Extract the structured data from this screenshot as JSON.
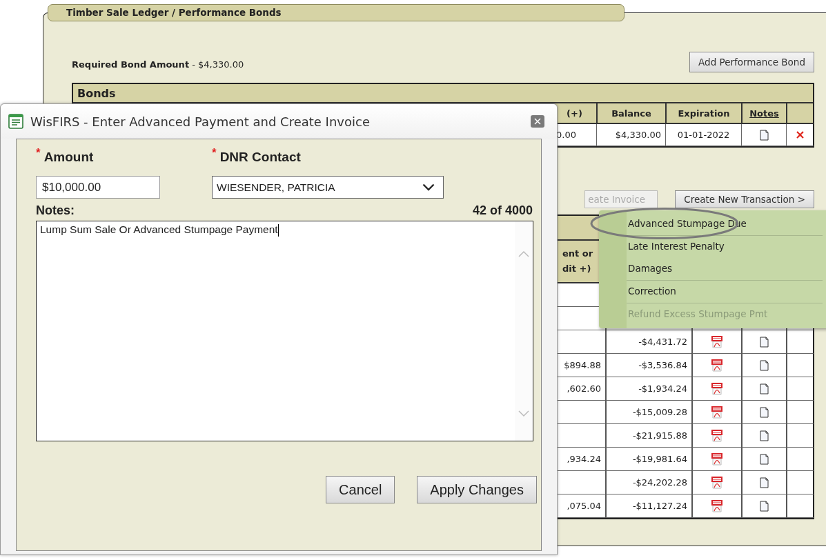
{
  "page": {
    "title": "Timber Sale Ledger / Performance Bonds",
    "required_bond": {
      "label": "Required Bond Amount",
      "value": "- $4,330.00"
    },
    "add_button": "Add Performance Bond",
    "bonds": {
      "title": "Bonds",
      "columns": [
        "(+)",
        "Balance",
        "Expiration",
        "Notes"
      ],
      "rows": [
        {
          "column_1": "0.00",
          "balance": "$4,330.00",
          "expiration": "01-01-2022"
        }
      ]
    },
    "actions": [
      {
        "label": "eate Invoice",
        "disabled": true
      },
      {
        "label": "Create New Transaction >",
        "disabled": false
      }
    ],
    "transactions": {
      "column_header": [
        "ent or",
        "dit +)"
      ],
      "rows": [
        {
          "kind": "blank",
          "column_1": "",
          "balance": ""
        },
        {
          "kind": "entry",
          "column_1": "",
          "balance": ""
        },
        {
          "kind": "entry",
          "column_1": "",
          "balance": "-$4,431.72"
        },
        {
          "kind": "entry",
          "column_1": "$894.88",
          "balance": "-$3,536.84"
        },
        {
          "kind": "entry",
          "column_1": ",602.60",
          "balance": "-$1,934.24"
        },
        {
          "kind": "entry",
          "column_1": "",
          "balance": "-$15,009.28"
        },
        {
          "kind": "entry",
          "column_1": "",
          "balance": "-$21,915.88"
        },
        {
          "kind": "entry",
          "column_1": ",934.24",
          "balance": "-$19,981.64"
        },
        {
          "kind": "entry",
          "column_1": "",
          "balance": "-$24,202.28"
        },
        {
          "kind": "entry",
          "column_1": ",075.04",
          "balance": "-$11,127.24"
        }
      ]
    }
  },
  "dialog": {
    "title": "WisFIRS - Enter Advanced Payment and Create Invoice",
    "amount": {
      "label": "Amount",
      "required_mark": "*",
      "value": "$10,000.00"
    },
    "contact": {
      "label": "DNR Contact",
      "required_mark": "*",
      "value": "WIESENDER, PATRICIA"
    },
    "notes": {
      "label": "Notes:",
      "counter": "42 of 4000",
      "value": "Lump Sum Sale Or Advanced Stumpage Payment"
    },
    "buttons": [
      "Cancel",
      "Apply Changes"
    ]
  },
  "menu": {
    "highlighted": true,
    "groups": [
      [
        {
          "label": "Advanced Stumpage Due",
          "disabled": false
        }
      ],
      [
        {
          "label": "Late Interest Penalty",
          "disabled": false
        },
        {
          "label": "Damages",
          "disabled": false
        }
      ],
      [
        {
          "label": "Correction",
          "disabled": false
        }
      ],
      [
        {
          "label": "Refund Excess Stumpage Pmt",
          "disabled": true
        }
      ]
    ]
  }
}
